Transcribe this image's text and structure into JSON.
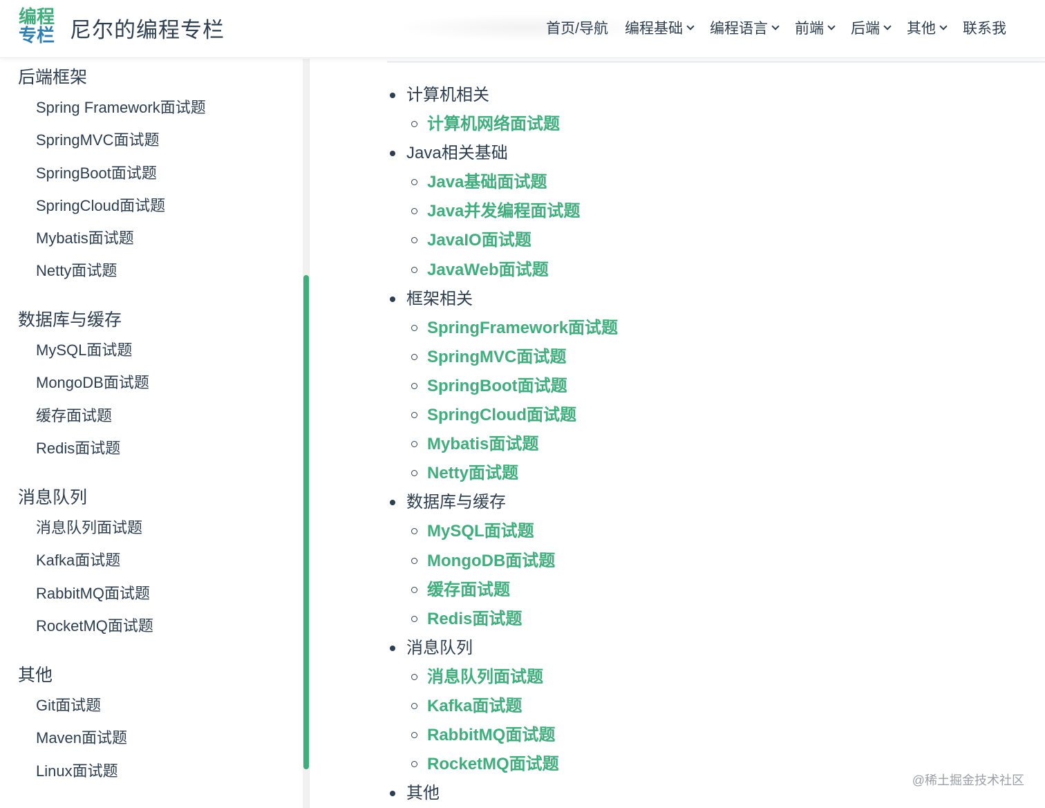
{
  "header": {
    "logo_line1": "编程",
    "logo_line2": "专栏",
    "site_name": "尼尔的编程专栏",
    "nav": [
      {
        "label": "首页/导航",
        "dropdown": false
      },
      {
        "label": "编程基础",
        "dropdown": true
      },
      {
        "label": "编程语言",
        "dropdown": true
      },
      {
        "label": "前端",
        "dropdown": true
      },
      {
        "label": "后端",
        "dropdown": true
      },
      {
        "label": "其他",
        "dropdown": true
      },
      {
        "label": "联系我",
        "dropdown": false
      }
    ]
  },
  "sidebar": {
    "groups": [
      {
        "title": "后端框架",
        "items": [
          "Spring Framework面试题",
          "SpringMVC面试题",
          "SpringBoot面试题",
          "SpringCloud面试题",
          "Mybatis面试题",
          "Netty面试题"
        ]
      },
      {
        "title": "数据库与缓存",
        "items": [
          "MySQL面试题",
          "MongoDB面试题",
          "缓存面试题",
          "Redis面试题"
        ]
      },
      {
        "title": "消息队列",
        "items": [
          "消息队列面试题",
          "Kafka面试题",
          "RabbitMQ面试题",
          "RocketMQ面试题"
        ]
      },
      {
        "title": "其他",
        "items": [
          "Git面试题",
          "Maven面试题",
          "Linux面试题"
        ]
      }
    ]
  },
  "content": {
    "categories": [
      {
        "title": "计算机相关",
        "links": [
          "计算机网络面试题"
        ]
      },
      {
        "title": "Java相关基础",
        "links": [
          "Java基础面试题",
          "Java并发编程面试题",
          "JavaIO面试题",
          "JavaWeb面试题"
        ]
      },
      {
        "title": "框架相关",
        "links": [
          "SpringFramework面试题",
          "SpringMVC面试题",
          "SpringBoot面试题",
          "SpringCloud面试题",
          "Mybatis面试题",
          "Netty面试题"
        ]
      },
      {
        "title": "数据库与缓存",
        "links": [
          "MySQL面试题",
          "MongoDB面试题",
          "缓存面试题",
          "Redis面试题"
        ]
      },
      {
        "title": "消息队列",
        "links": [
          "消息队列面试题",
          "Kafka面试题",
          "RabbitMQ面试题",
          "RocketMQ面试题"
        ]
      },
      {
        "title": "其他",
        "links": []
      }
    ]
  },
  "watermark": "@稀土掘金技术社区",
  "colors": {
    "accent": "#3eaf7c",
    "text": "#2c3e50",
    "logo_blue": "#2f7fb5"
  }
}
